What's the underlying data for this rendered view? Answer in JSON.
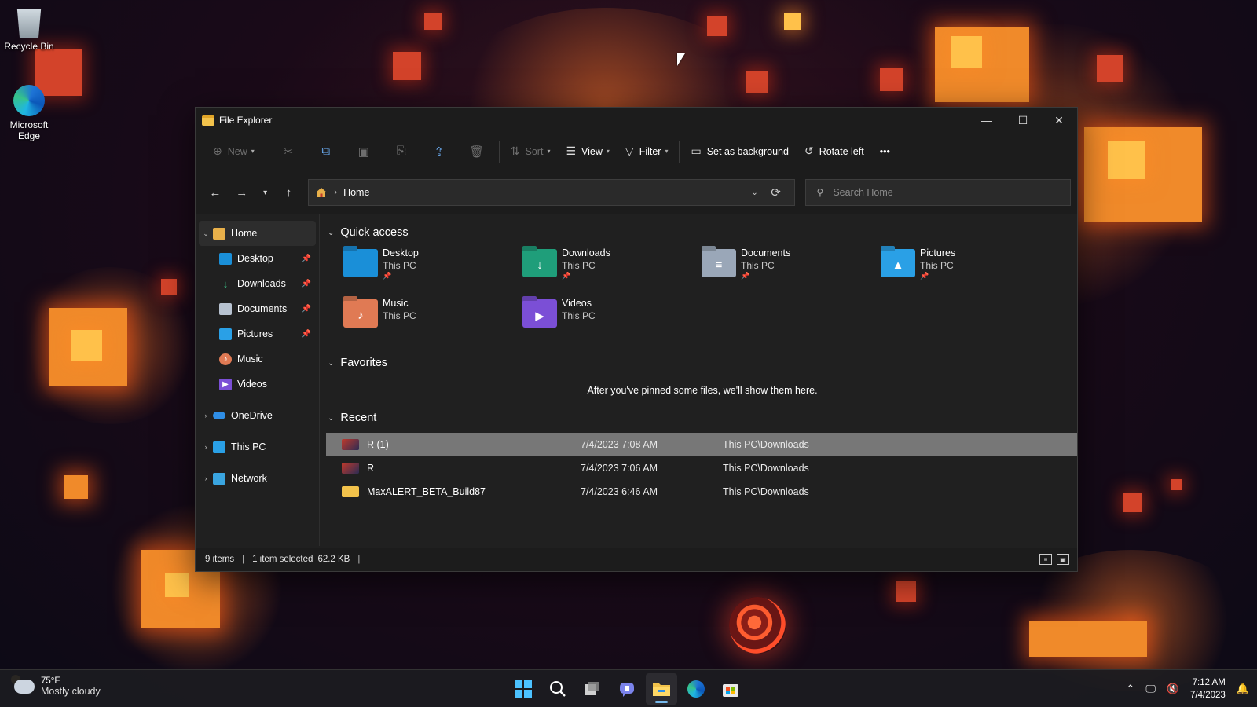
{
  "desktop": {
    "icons": [
      {
        "label": "Recycle Bin"
      },
      {
        "label": "Microsoft Edge"
      }
    ]
  },
  "window": {
    "title": "File Explorer",
    "controls": {
      "minimize": "—",
      "maximize": "☐",
      "close": "✕"
    }
  },
  "toolbar": {
    "new_label": "New",
    "sort_label": "Sort",
    "view_label": "View",
    "filter_label": "Filter",
    "set_background_label": "Set as background",
    "rotate_left_label": "Rotate left",
    "more_label": "•••"
  },
  "address": {
    "crumb": "Home",
    "search_placeholder": "Search Home"
  },
  "sidebar": {
    "items": [
      {
        "label": "Home"
      },
      {
        "label": "Desktop"
      },
      {
        "label": "Downloads"
      },
      {
        "label": "Documents"
      },
      {
        "label": "Pictures"
      },
      {
        "label": "Music"
      },
      {
        "label": "Videos"
      },
      {
        "label": "OneDrive"
      },
      {
        "label": "This PC"
      },
      {
        "label": "Network"
      }
    ]
  },
  "quick_access": {
    "heading": "Quick access",
    "items": [
      {
        "name": "Desktop",
        "location": "This PC",
        "color": "#1a8fd8"
      },
      {
        "name": "Downloads",
        "location": "This PC",
        "color": "#1f9e7a"
      },
      {
        "name": "Documents",
        "location": "This PC",
        "color": "#9aa7b8"
      },
      {
        "name": "Pictures",
        "location": "This PC",
        "color": "#2aa0e6"
      },
      {
        "name": "Music",
        "location": "This PC",
        "color": "#e07a54"
      },
      {
        "name": "Videos",
        "location": "This PC",
        "color": "#7b4fd6"
      }
    ]
  },
  "favorites": {
    "heading": "Favorites",
    "empty_message": "After you've pinned some files, we'll show them here."
  },
  "recent": {
    "heading": "Recent",
    "rows": [
      {
        "name": "R (1)",
        "date": "7/4/2023 7:08 AM",
        "location": "This PC\\Downloads"
      },
      {
        "name": "R",
        "date": "7/4/2023 7:06 AM",
        "location": "This PC\\Downloads"
      },
      {
        "name": "MaxALERT_BETA_Build87",
        "date": "7/4/2023 6:46 AM",
        "location": "This PC\\Downloads"
      }
    ]
  },
  "status": {
    "items": "9 items",
    "selected": "1 item selected",
    "size": "62.2 KB"
  },
  "taskbar": {
    "temperature": "75°F",
    "condition": "Mostly cloudy",
    "time": "7:12 AM",
    "date": "7/4/2023"
  },
  "colors": {
    "selection": "#777777",
    "accent": "#76b9ed"
  }
}
